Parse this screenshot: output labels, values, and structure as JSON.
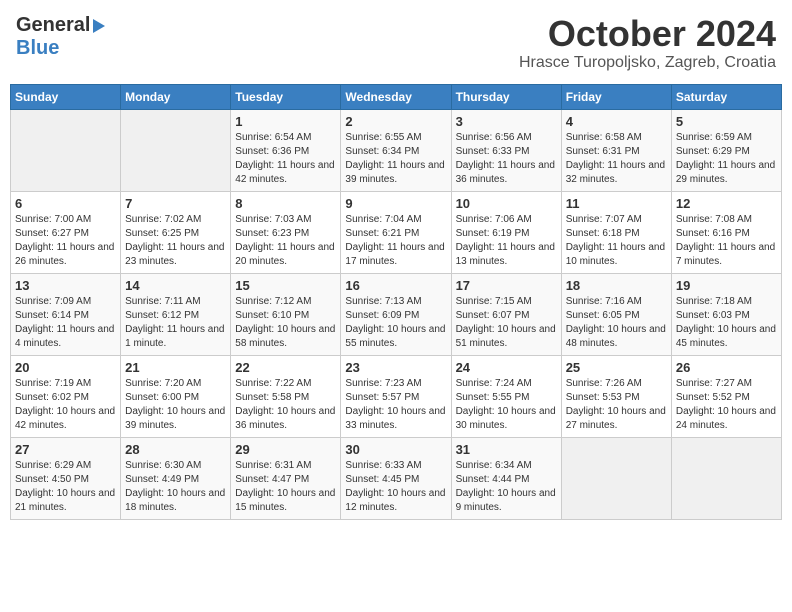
{
  "header": {
    "logo_general": "General",
    "logo_blue": "Blue",
    "month": "October 2024",
    "location": "Hrasce Turopoljsko, Zagreb, Croatia"
  },
  "days_of_week": [
    "Sunday",
    "Monday",
    "Tuesday",
    "Wednesday",
    "Thursday",
    "Friday",
    "Saturday"
  ],
  "weeks": [
    [
      {
        "day": "",
        "sunrise": "",
        "sunset": "",
        "daylight": ""
      },
      {
        "day": "",
        "sunrise": "",
        "sunset": "",
        "daylight": ""
      },
      {
        "day": "1",
        "sunrise": "Sunrise: 6:54 AM",
        "sunset": "Sunset: 6:36 PM",
        "daylight": "Daylight: 11 hours and 42 minutes."
      },
      {
        "day": "2",
        "sunrise": "Sunrise: 6:55 AM",
        "sunset": "Sunset: 6:34 PM",
        "daylight": "Daylight: 11 hours and 39 minutes."
      },
      {
        "day": "3",
        "sunrise": "Sunrise: 6:56 AM",
        "sunset": "Sunset: 6:33 PM",
        "daylight": "Daylight: 11 hours and 36 minutes."
      },
      {
        "day": "4",
        "sunrise": "Sunrise: 6:58 AM",
        "sunset": "Sunset: 6:31 PM",
        "daylight": "Daylight: 11 hours and 32 minutes."
      },
      {
        "day": "5",
        "sunrise": "Sunrise: 6:59 AM",
        "sunset": "Sunset: 6:29 PM",
        "daylight": "Daylight: 11 hours and 29 minutes."
      }
    ],
    [
      {
        "day": "6",
        "sunrise": "Sunrise: 7:00 AM",
        "sunset": "Sunset: 6:27 PM",
        "daylight": "Daylight: 11 hours and 26 minutes."
      },
      {
        "day": "7",
        "sunrise": "Sunrise: 7:02 AM",
        "sunset": "Sunset: 6:25 PM",
        "daylight": "Daylight: 11 hours and 23 minutes."
      },
      {
        "day": "8",
        "sunrise": "Sunrise: 7:03 AM",
        "sunset": "Sunset: 6:23 PM",
        "daylight": "Daylight: 11 hours and 20 minutes."
      },
      {
        "day": "9",
        "sunrise": "Sunrise: 7:04 AM",
        "sunset": "Sunset: 6:21 PM",
        "daylight": "Daylight: 11 hours and 17 minutes."
      },
      {
        "day": "10",
        "sunrise": "Sunrise: 7:06 AM",
        "sunset": "Sunset: 6:19 PM",
        "daylight": "Daylight: 11 hours and 13 minutes."
      },
      {
        "day": "11",
        "sunrise": "Sunrise: 7:07 AM",
        "sunset": "Sunset: 6:18 PM",
        "daylight": "Daylight: 11 hours and 10 minutes."
      },
      {
        "day": "12",
        "sunrise": "Sunrise: 7:08 AM",
        "sunset": "Sunset: 6:16 PM",
        "daylight": "Daylight: 11 hours and 7 minutes."
      }
    ],
    [
      {
        "day": "13",
        "sunrise": "Sunrise: 7:09 AM",
        "sunset": "Sunset: 6:14 PM",
        "daylight": "Daylight: 11 hours and 4 minutes."
      },
      {
        "day": "14",
        "sunrise": "Sunrise: 7:11 AM",
        "sunset": "Sunset: 6:12 PM",
        "daylight": "Daylight: 11 hours and 1 minute."
      },
      {
        "day": "15",
        "sunrise": "Sunrise: 7:12 AM",
        "sunset": "Sunset: 6:10 PM",
        "daylight": "Daylight: 10 hours and 58 minutes."
      },
      {
        "day": "16",
        "sunrise": "Sunrise: 7:13 AM",
        "sunset": "Sunset: 6:09 PM",
        "daylight": "Daylight: 10 hours and 55 minutes."
      },
      {
        "day": "17",
        "sunrise": "Sunrise: 7:15 AM",
        "sunset": "Sunset: 6:07 PM",
        "daylight": "Daylight: 10 hours and 51 minutes."
      },
      {
        "day": "18",
        "sunrise": "Sunrise: 7:16 AM",
        "sunset": "Sunset: 6:05 PM",
        "daylight": "Daylight: 10 hours and 48 minutes."
      },
      {
        "day": "19",
        "sunrise": "Sunrise: 7:18 AM",
        "sunset": "Sunset: 6:03 PM",
        "daylight": "Daylight: 10 hours and 45 minutes."
      }
    ],
    [
      {
        "day": "20",
        "sunrise": "Sunrise: 7:19 AM",
        "sunset": "Sunset: 6:02 PM",
        "daylight": "Daylight: 10 hours and 42 minutes."
      },
      {
        "day": "21",
        "sunrise": "Sunrise: 7:20 AM",
        "sunset": "Sunset: 6:00 PM",
        "daylight": "Daylight: 10 hours and 39 minutes."
      },
      {
        "day": "22",
        "sunrise": "Sunrise: 7:22 AM",
        "sunset": "Sunset: 5:58 PM",
        "daylight": "Daylight: 10 hours and 36 minutes."
      },
      {
        "day": "23",
        "sunrise": "Sunrise: 7:23 AM",
        "sunset": "Sunset: 5:57 PM",
        "daylight": "Daylight: 10 hours and 33 minutes."
      },
      {
        "day": "24",
        "sunrise": "Sunrise: 7:24 AM",
        "sunset": "Sunset: 5:55 PM",
        "daylight": "Daylight: 10 hours and 30 minutes."
      },
      {
        "day": "25",
        "sunrise": "Sunrise: 7:26 AM",
        "sunset": "Sunset: 5:53 PM",
        "daylight": "Daylight: 10 hours and 27 minutes."
      },
      {
        "day": "26",
        "sunrise": "Sunrise: 7:27 AM",
        "sunset": "Sunset: 5:52 PM",
        "daylight": "Daylight: 10 hours and 24 minutes."
      }
    ],
    [
      {
        "day": "27",
        "sunrise": "Sunrise: 6:29 AM",
        "sunset": "Sunset: 4:50 PM",
        "daylight": "Daylight: 10 hours and 21 minutes."
      },
      {
        "day": "28",
        "sunrise": "Sunrise: 6:30 AM",
        "sunset": "Sunset: 4:49 PM",
        "daylight": "Daylight: 10 hours and 18 minutes."
      },
      {
        "day": "29",
        "sunrise": "Sunrise: 6:31 AM",
        "sunset": "Sunset: 4:47 PM",
        "daylight": "Daylight: 10 hours and 15 minutes."
      },
      {
        "day": "30",
        "sunrise": "Sunrise: 6:33 AM",
        "sunset": "Sunset: 4:45 PM",
        "daylight": "Daylight: 10 hours and 12 minutes."
      },
      {
        "day": "31",
        "sunrise": "Sunrise: 6:34 AM",
        "sunset": "Sunset: 4:44 PM",
        "daylight": "Daylight: 10 hours and 9 minutes."
      },
      {
        "day": "",
        "sunrise": "",
        "sunset": "",
        "daylight": ""
      },
      {
        "day": "",
        "sunrise": "",
        "sunset": "",
        "daylight": ""
      }
    ]
  ]
}
